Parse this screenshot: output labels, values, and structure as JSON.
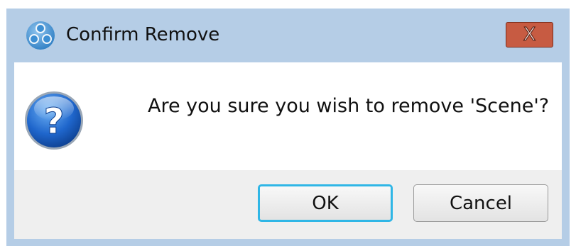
{
  "dialog": {
    "title": "Confirm Remove",
    "close_label": "X",
    "app_icon": "obs-logo-icon",
    "message_icon": "question-icon",
    "message": "Are you sure you wish to remove 'Scene'?"
  },
  "buttons": {
    "ok_label": "OK",
    "cancel_label": "Cancel",
    "focused": "OK"
  },
  "colors": {
    "titlebar": "#b5cde6",
    "close_button": "#c75b42",
    "focus_ring": "#2fb6e6",
    "button_area": "#efefef"
  }
}
